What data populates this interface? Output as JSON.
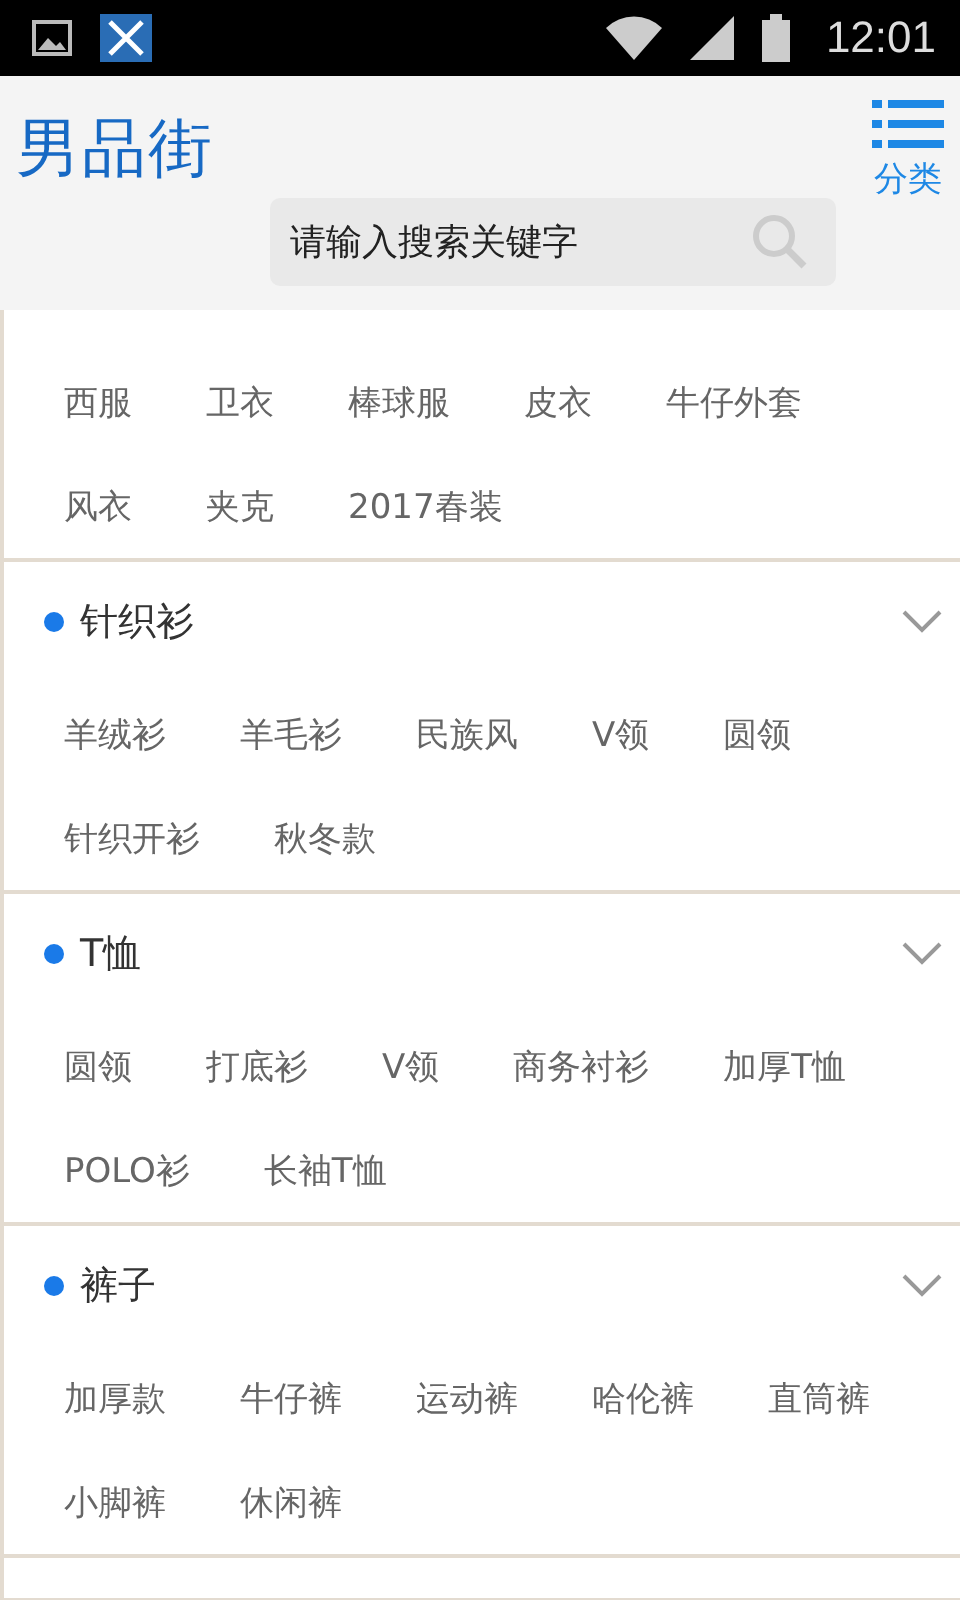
{
  "status_bar": {
    "time": "12:01"
  },
  "header": {
    "logo": "男品街",
    "menu_label": "分类",
    "search": {
      "placeholder": "请输入搜索关键字"
    }
  },
  "sections": [
    {
      "kind": "partial",
      "tags": [
        "西服",
        "卫衣",
        "棒球服",
        "皮衣",
        "牛仔外套",
        "风衣",
        "夹克",
        "2017春装"
      ]
    },
    {
      "kind": "full",
      "title": "针织衫",
      "expanded": true,
      "tags": [
        "羊绒衫",
        "羊毛衫",
        "民族风",
        "V领",
        "圆领",
        "针织开衫",
        "秋冬款"
      ]
    },
    {
      "kind": "full",
      "title": "T恤",
      "expanded": true,
      "tags": [
        "圆领",
        "打底衫",
        "V领",
        "商务衬衫",
        "加厚T恤",
        "POLO衫",
        "长袖T恤"
      ]
    },
    {
      "kind": "full",
      "title": "裤子",
      "expanded": true,
      "tags": [
        "加厚款",
        "牛仔裤",
        "运动裤",
        "哈伦裤",
        "直筒裤",
        "小脚裤",
        "休闲裤"
      ]
    },
    {
      "kind": "partial"
    }
  ]
}
